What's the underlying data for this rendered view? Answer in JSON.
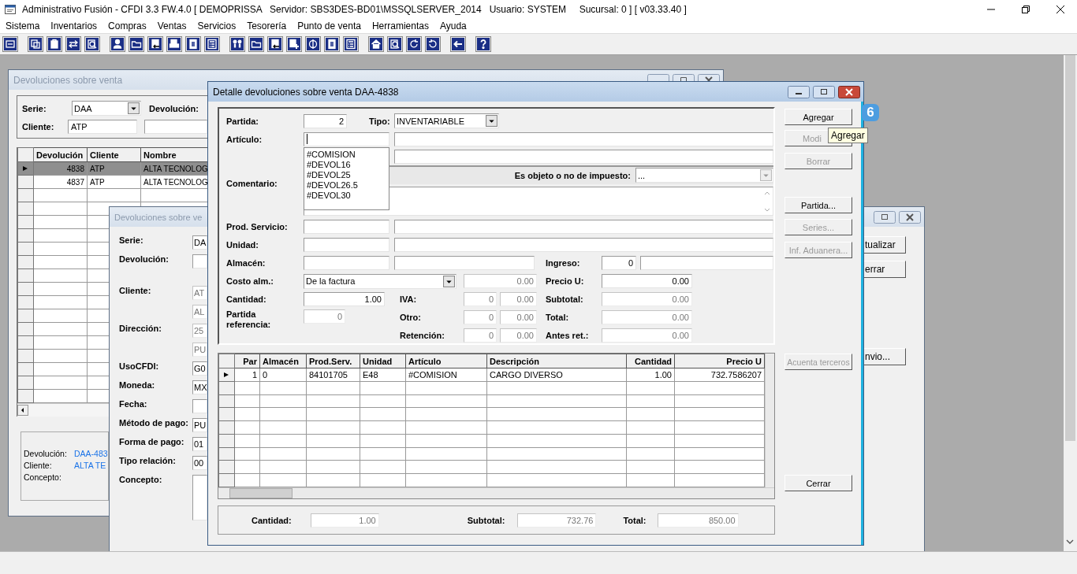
{
  "app": {
    "title": "Administrativo Fusión - CFDI 3.3 FW.4.0 [ DEMOPRISSA   Servidor: SBS3DES-BD01\\MSSQLSERVER_2014   Usuario: SYSTEM     Sucursal: 0 ] [ v03.33.40 ]",
    "menu": [
      "Sistema",
      "Inventarios",
      "Compras",
      "Ventas",
      "Servicios",
      "Tesorería",
      "Punto de venta",
      "Herramientas",
      "Ayuda"
    ]
  },
  "list_window": {
    "title": "Devoluciones sobre venta",
    "filter": {
      "serie_label": "Serie:",
      "serie_value": "DAA",
      "devolucion_label": "Devolución:",
      "cliente_label": "Cliente:",
      "cliente_value": "ATP"
    },
    "grid": {
      "columns": [
        "Devolución",
        "Cliente",
        "Nombre"
      ],
      "rows": [
        {
          "devolucion": "4838",
          "cliente": "ATP",
          "nombre": "ALTA TECNOLOG",
          "selected": true
        },
        {
          "devolucion": "4837",
          "cliente": "ATP",
          "nombre": "ALTA TECNOLOG",
          "selected": false
        }
      ]
    },
    "info": [
      {
        "label": "Devolución:",
        "value": "DAA-483"
      },
      {
        "label": "Cliente:",
        "value": "ALTA TE"
      },
      {
        "label": "Concepto:"
      }
    ]
  },
  "edit_window": {
    "title": "Devoluciones sobre ve",
    "fields": [
      {
        "label": "Serie:",
        "value": "DA",
        "disabled": false,
        "kind": "field"
      },
      {
        "label": "Devolución:",
        "disabled": false,
        "kind": "field"
      },
      {
        "label": "Cliente:",
        "value": "AT",
        "disabled": true,
        "kind": "field"
      },
      {
        "value": "AL",
        "disabled": true,
        "kind": "field"
      },
      {
        "label": "Dirección:",
        "value": "25",
        "disabled": true,
        "kind": "field"
      },
      {
        "value": "PU",
        "disabled": true,
        "kind": "field"
      },
      {
        "label": "UsoCFDI:",
        "value": "G0",
        "disabled": false,
        "kind": "field"
      },
      {
        "label": "Moneda:",
        "value": "MX",
        "disabled": false,
        "kind": "field"
      },
      {
        "label": "Fecha:",
        "disabled": false,
        "kind": "field"
      },
      {
        "label": "Método de pago:",
        "value": "PU",
        "disabled": false,
        "kind": "field"
      },
      {
        "label": "Forma de pago:",
        "value": "01",
        "disabled": false,
        "kind": "field"
      },
      {
        "label": "Tipo relación:",
        "value": "00",
        "disabled": false,
        "kind": "field"
      },
      {
        "label": "Concepto:",
        "disabled": false,
        "kind": "textarea"
      }
    ],
    "buttons": [
      "tualizar",
      "errar",
      "nvio..."
    ]
  },
  "detail_window": {
    "title": "Detalle devoluciones sobre venta DAA-4838",
    "form": {
      "partida": {
        "label": "Partida:",
        "value": "2"
      },
      "tipo": {
        "label": "Tipo:",
        "value": "INVENTARIABLE"
      },
      "articulo": {
        "label": "Artículo:"
      },
      "suggestions": [
        "#COMISION",
        "#DEVOL16",
        "#DEVOL25",
        "#DEVOL26.5",
        "#DEVOL30"
      ],
      "impuesto": {
        "label": "Es objeto o no de impuesto:",
        "value": "...",
        "disabled": true
      },
      "comentario": {
        "label": "Comentario:"
      },
      "prod_servicio": {
        "label": "Prod. Servicio:"
      },
      "unidad": {
        "label": "Unidad:"
      },
      "almacen": {
        "label": "Almacén:"
      },
      "ingreso": {
        "label": "Ingreso:",
        "value": "0"
      },
      "costo_alm": {
        "label": "Costo alm.:",
        "value": "De la factura",
        "amount": "0.00"
      },
      "precio_u": {
        "label": "Precio U:",
        "value": "0.00",
        "disabled": false
      },
      "cantidad": {
        "label": "Cantidad:",
        "value": "1.00"
      },
      "iva": {
        "label": "IVA:",
        "rate": "0",
        "amount": "0.00"
      },
      "otro": {
        "label": "Otro:",
        "rate": "0",
        "amount": "0.00"
      },
      "retencion": {
        "label": "Retención:",
        "rate": "0",
        "amount": "0.00"
      },
      "subtotal": {
        "label": "Subtotal:",
        "value": "0.00",
        "disabled": true
      },
      "total": {
        "label": "Total:",
        "value": "0.00",
        "disabled": true
      },
      "antes_ret": {
        "label": "Antes ret.:",
        "value": "0.00",
        "disabled": true
      },
      "partida_referencia": {
        "label": "Partida referencia:",
        "value": "0"
      }
    },
    "table": {
      "columns": [
        "Par",
        "Almacén",
        "Prod.Serv.",
        "Unidad",
        "Artículo",
        "Descripción",
        "Cantidad",
        "Precio U"
      ],
      "rows": [
        {
          "selected": true,
          "cells": [
            "1",
            "0",
            "84101705",
            "E48",
            "#COMISION",
            "CARGO DIVERSO",
            "1.00",
            "732.7586207"
          ]
        }
      ]
    },
    "totals": [
      {
        "label": "Cantidad:",
        "value": "1.00"
      },
      {
        "label": "Subtotal:",
        "value": "732.76"
      },
      {
        "label": "Total:",
        "value": "850.00"
      }
    ],
    "buttons": [
      {
        "label": "Agregar",
        "disabled": false
      },
      {
        "label": "Modi",
        "disabled": true
      },
      {
        "label": "Borrar",
        "disabled": true
      },
      {
        "label": "Partida...",
        "disabled": false
      },
      {
        "label": "Series...",
        "disabled": true
      },
      {
        "label": "Inf. Aduanera...",
        "disabled": true
      },
      {
        "label": "Acuenta terceros",
        "disabled": true
      },
      {
        "label": "Cerrar",
        "disabled": false
      }
    ],
    "tooltip": "Agregar",
    "step_badge": "6"
  }
}
